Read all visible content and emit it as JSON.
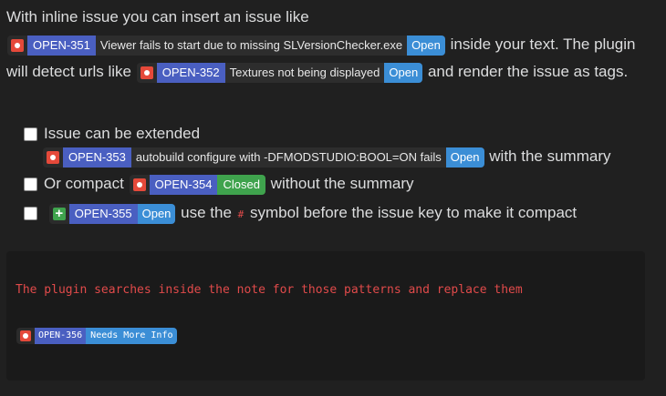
{
  "intro": {
    "text1": "With inline issue you can insert an issue like",
    "text2": "inside your text. The plugin will detect urls like",
    "text3": "and render the issue as tags."
  },
  "issues": {
    "i351": {
      "key": "OPEN-351",
      "summary": "Viewer fails to start due to missing SLVersionChecker.exe",
      "status": "Open",
      "icon": "bug-icon"
    },
    "i352": {
      "key": "OPEN-352",
      "summary": "Textures not being displayed",
      "status": "Open",
      "icon": "bug-icon"
    },
    "i353": {
      "key": "OPEN-353",
      "summary": "autobuild configure with -DFMODSTUDIO:BOOL=ON fails",
      "status": "Open",
      "icon": "bug-icon"
    },
    "i354": {
      "key": "OPEN-354",
      "status": "Closed",
      "icon": "bug-icon"
    },
    "i355": {
      "key": "OPEN-355",
      "status": "Open",
      "icon": "plus-icon"
    },
    "i356": {
      "key": "OPEN-356",
      "status": "Needs More Info",
      "icon": "bug-icon"
    }
  },
  "list": {
    "item1": "Issue can be extended",
    "item1_tail": "with the summary",
    "item2": "Or compact",
    "item2_tail": "without the summary",
    "item3_tail_a": "use the",
    "hash": "#",
    "item3_tail_b": "symbol before the issue key to make it compact"
  },
  "code": {
    "line": "The plugin searches inside the note for those patterns and replace them"
  },
  "colors": {
    "background": "#202020",
    "key": "#4a5fc1",
    "open": "#3b8ed6",
    "closed": "#3fa34d",
    "bug": "#e5493a",
    "code_text": "#e04a4a"
  }
}
